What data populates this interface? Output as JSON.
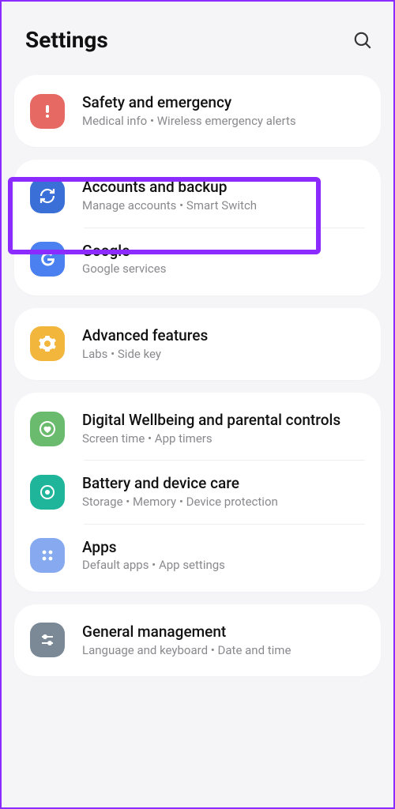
{
  "header": {
    "title": "Settings"
  },
  "groups": [
    {
      "items": [
        {
          "key": "safety",
          "title": "Safety and emergency",
          "subtitle": "Medical info  •  Wireless emergency alerts",
          "iconBg": "#e66a63",
          "icon": "alert"
        }
      ]
    },
    {
      "items": [
        {
          "key": "accounts",
          "title": "Accounts and backup",
          "subtitle": "Manage accounts  •  Smart Switch",
          "iconBg": "#3b6fd8",
          "icon": "sync",
          "highlighted": true
        },
        {
          "key": "google",
          "title": "Google",
          "subtitle": "Google services",
          "iconBg": "#4a80ef",
          "icon": "google"
        }
      ]
    },
    {
      "items": [
        {
          "key": "advanced",
          "title": "Advanced features",
          "subtitle": "Labs  •  Side key",
          "iconBg": "#f2b63c",
          "icon": "gear"
        }
      ]
    },
    {
      "items": [
        {
          "key": "wellbeing",
          "title": "Digital Wellbeing and parental controls",
          "subtitle": "Screen time  •  App timers",
          "iconBg": "#6bbb6e",
          "icon": "heart"
        },
        {
          "key": "battery",
          "title": "Battery and device care",
          "subtitle": "Storage  •  Memory  •  Device protection",
          "iconBg": "#1fb59a",
          "icon": "care"
        },
        {
          "key": "apps",
          "title": "Apps",
          "subtitle": "Default apps  •  App settings",
          "iconBg": "#86a9ef",
          "icon": "apps"
        }
      ]
    },
    {
      "items": [
        {
          "key": "general",
          "title": "General management",
          "subtitle": "Language and keyboard  •  Date and time",
          "iconBg": "#7b8895",
          "icon": "sliders"
        }
      ]
    }
  ]
}
